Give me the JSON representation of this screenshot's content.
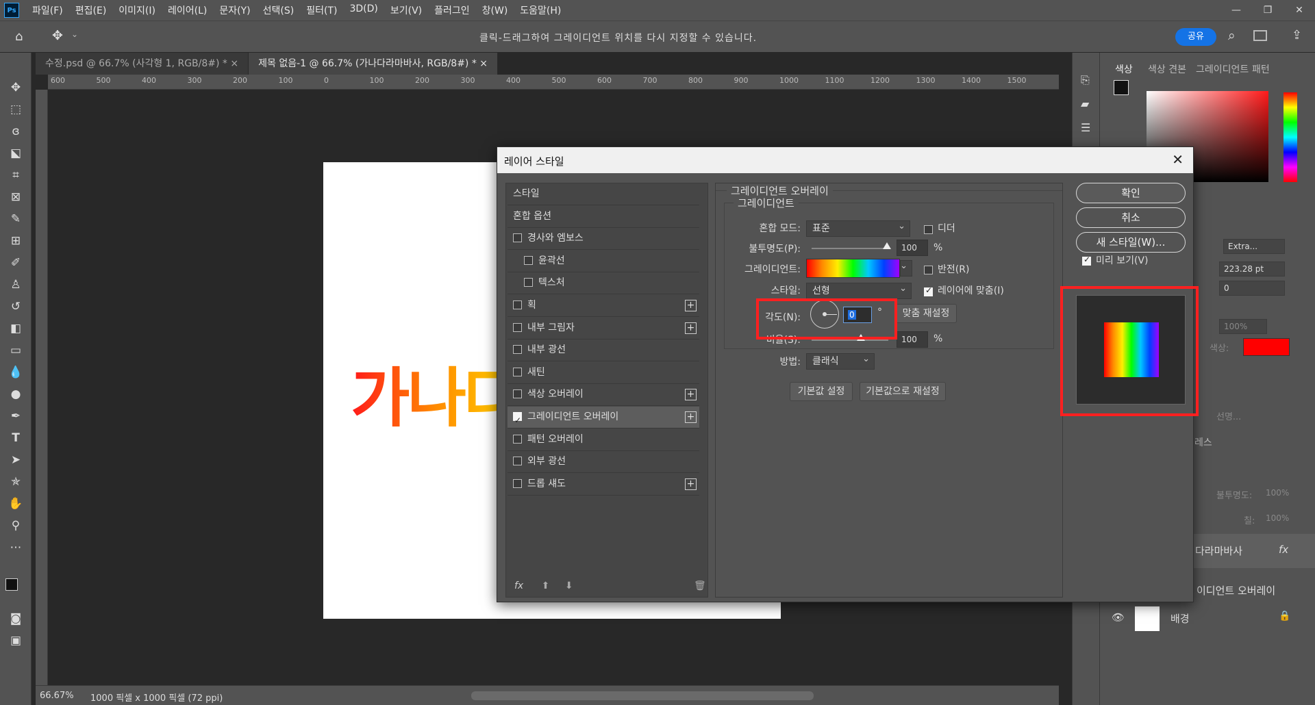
{
  "app": {
    "logo": "Ps",
    "menu": [
      "파일(F)",
      "편집(E)",
      "이미지(I)",
      "레이어(L)",
      "문자(Y)",
      "선택(S)",
      "필터(T)",
      "3D(D)",
      "보기(V)",
      "플러그인",
      "창(W)",
      "도움말(H)"
    ],
    "window_controls": [
      "—",
      "❐",
      "✕"
    ]
  },
  "options_bar": {
    "hint": "클릭-드래그하여 그레이디언트 위치를 다시 지정할 수 있습니다.",
    "share": "공유"
  },
  "tabs": [
    {
      "label": "수정.psd @ 66.7% (사각형 1, RGB/8#) *",
      "close": "×"
    },
    {
      "label": "제목 없음-1 @ 66.7% (가나다라마바사, RGB/8#) *",
      "close": "×"
    }
  ],
  "ruler_ticks": [
    "600",
    "500",
    "400",
    "300",
    "200",
    "100",
    "0",
    "100",
    "200",
    "300",
    "400",
    "500",
    "600",
    "700",
    "800",
    "900",
    "1000",
    "1100",
    "1200",
    "1300",
    "1400",
    "1500"
  ],
  "canvas": {
    "doc_text": "가나다"
  },
  "status": {
    "zoom": "66.67%",
    "size": "1000 픽셀 x 1000 픽셀 (72 ppi)"
  },
  "panels": {
    "color_tabs": [
      "색상",
      "색상 견본",
      "그레이디언트",
      "패턴"
    ],
    "char": {
      "font_style": "Extra...",
      "leading": "223.28 pt",
      "tracking": "0",
      "scale": "100%",
      "color_label": "색상:",
      "lang": "선명..."
    },
    "layers": {
      "tab_partial": "레스",
      "opacity_label": "불투명도:",
      "opacity": "100%",
      "fill_label": "칠:",
      "fill": "100%",
      "text_layer": "다라마바사",
      "effect": "이디언트 오버레이",
      "bg_layer": "배경"
    }
  },
  "dialog": {
    "title": "레이어 스타일",
    "close": "✕",
    "styles": [
      {
        "label": "스타일",
        "check": false,
        "has_cb": false,
        "plus": false,
        "indent": false,
        "selected": false
      },
      {
        "label": "혼합 옵션",
        "check": false,
        "has_cb": false,
        "plus": false,
        "indent": false,
        "selected": false
      },
      {
        "label": "경사와 엠보스",
        "check": false,
        "has_cb": true,
        "plus": false,
        "indent": false,
        "selected": false
      },
      {
        "label": "윤곽선",
        "check": false,
        "has_cb": true,
        "plus": false,
        "indent": true,
        "selected": false
      },
      {
        "label": "텍스처",
        "check": false,
        "has_cb": true,
        "plus": false,
        "indent": true,
        "selected": false
      },
      {
        "label": "획",
        "check": false,
        "has_cb": true,
        "plus": true,
        "indent": false,
        "selected": false
      },
      {
        "label": "내부 그림자",
        "check": false,
        "has_cb": true,
        "plus": true,
        "indent": false,
        "selected": false
      },
      {
        "label": "내부 광선",
        "check": false,
        "has_cb": true,
        "plus": false,
        "indent": false,
        "selected": false
      },
      {
        "label": "새틴",
        "check": false,
        "has_cb": true,
        "plus": false,
        "indent": false,
        "selected": false
      },
      {
        "label": "색상 오버레이",
        "check": false,
        "has_cb": true,
        "plus": true,
        "indent": false,
        "selected": false
      },
      {
        "label": "그레이디언트 오버레이",
        "check": true,
        "has_cb": true,
        "plus": true,
        "indent": false,
        "selected": true
      },
      {
        "label": "패턴 오버레이",
        "check": false,
        "has_cb": true,
        "plus": false,
        "indent": false,
        "selected": false
      },
      {
        "label": "외부 광선",
        "check": false,
        "has_cb": true,
        "plus": false,
        "indent": false,
        "selected": false
      },
      {
        "label": "드롭 섀도",
        "check": false,
        "has_cb": true,
        "plus": true,
        "indent": false,
        "selected": false
      }
    ],
    "settings": {
      "section": "그레이디언트 오버레이",
      "group": "그레이디언트",
      "blend_label": "혼합 모드:",
      "blend_value": "표준",
      "dither_label": "디더",
      "opacity_label": "불투명도(P):",
      "opacity_value": "100",
      "pct": "%",
      "gradient_label": "그레이디언트:",
      "reverse_label": "반전(R)",
      "style_label": "스타일:",
      "style_value": "선형",
      "align_label": "레이어에 맞춤(I)",
      "angle_label": "각도(N):",
      "angle_value": "0",
      "degree": "°",
      "reset_align": "맞춤 재설정",
      "scale_label": "비율(S):",
      "scale_value": "100",
      "method_label": "방법:",
      "method_value": "클래식",
      "make_default": "기본값 설정",
      "reset_default": "기본값으로 재설정"
    },
    "buttons": {
      "ok": "확인",
      "cancel": "취소",
      "new_style": "새 스타일(W)...",
      "preview": "미리 보기(V)"
    }
  },
  "colors": {
    "highlight": "#ff2020",
    "accent": "#1473e6"
  }
}
